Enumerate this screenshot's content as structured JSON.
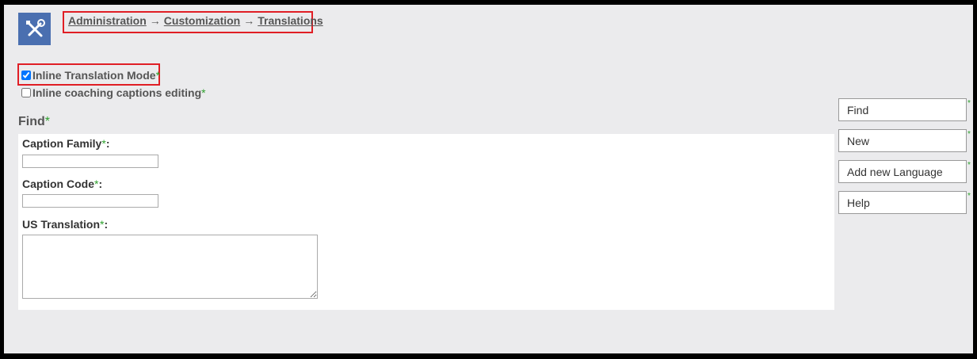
{
  "breadcrumb": {
    "items": [
      "Administration",
      "Customization",
      "Translations"
    ],
    "separator": "→"
  },
  "options": {
    "inline_translation_mode": {
      "label": "Inline Translation Mode",
      "required_mark": "*",
      "checked": true
    },
    "inline_coaching_captions": {
      "label": "Inline coaching captions editing",
      "required_mark": "*",
      "checked": false
    }
  },
  "find": {
    "title": "Find",
    "required_mark": "*",
    "fields": {
      "caption_family": {
        "label": "Caption Family",
        "required_mark": "*",
        "suffix": ":",
        "value": ""
      },
      "caption_code": {
        "label": "Caption Code",
        "required_mark": "*",
        "suffix": ":",
        "value": ""
      },
      "us_translation": {
        "label": "US Translation",
        "required_mark": "*",
        "suffix": ":",
        "value": ""
      }
    }
  },
  "actions": {
    "find": {
      "label": "Find",
      "required_mark": "*"
    },
    "new": {
      "label": "New",
      "required_mark": "*"
    },
    "add_language": {
      "label": "Add new Language",
      "required_mark": "*"
    },
    "help": {
      "label": "Help",
      "required_mark": "*"
    }
  },
  "icons": {
    "app_logo": "tools-icon"
  },
  "colors": {
    "logo_bg": "#4a6fb0",
    "highlight": "#e01e25",
    "required_star": "#2ea02e",
    "page_bg": "#ebebed"
  }
}
